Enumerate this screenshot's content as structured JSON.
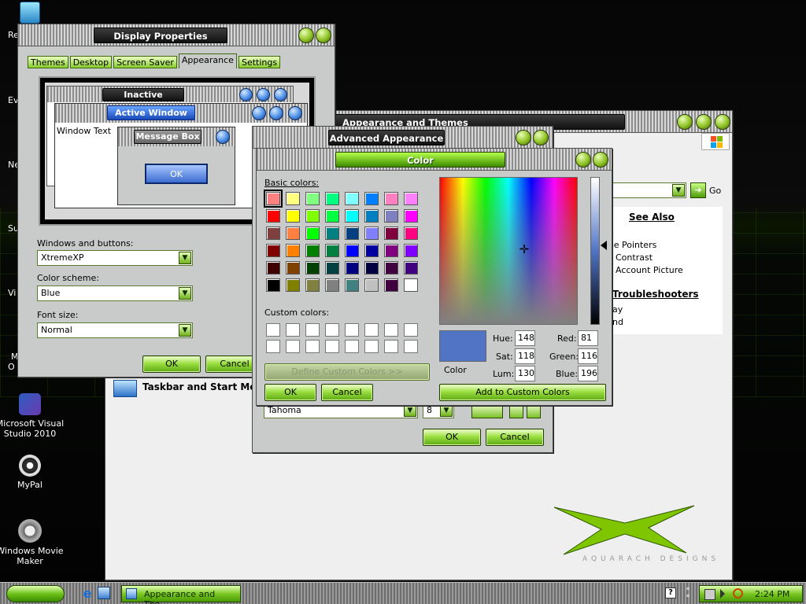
{
  "desktop": {
    "stubs": [
      "Re",
      "Ev",
      "Ne",
      "Su",
      "Vi",
      "M",
      "O"
    ],
    "icons": [
      {
        "label": "Microsoft Visual Studio 2010"
      },
      {
        "label": "MyPal"
      },
      {
        "label": "Windows Movie Maker"
      }
    ]
  },
  "display_properties": {
    "title": "Display Properties",
    "tabs": [
      "Themes",
      "Desktop",
      "Screen Saver",
      "Appearance",
      "Settings"
    ],
    "selected_tab": "Appearance",
    "preview": {
      "inactive": "Inactive Window",
      "active": "Active Window",
      "window_text": "Window Text",
      "message_box": "Message Box",
      "ok": "OK"
    },
    "windows_buttons_label": "Windows and buttons:",
    "windows_buttons_value": "XtremeXP",
    "color_scheme_label": "Color scheme:",
    "color_scheme_value": "Blue",
    "font_size_label": "Font size:",
    "font_size_value": "Normal",
    "ok": "OK",
    "cancel": "Cancel"
  },
  "appearance_themes": {
    "title": "Appearance and Themes",
    "go": "Go",
    "see_also": "See Also",
    "see_also_items": [
      "s",
      "se Pointers",
      "Contrast",
      "Account Picture"
    ],
    "troubleshooters": "Troubleshooters",
    "troubleshooter_items": [
      "ay",
      "nd"
    ],
    "taskbar_link": "Taskbar and Start Menu",
    "brand": "AQUARACH DESIGNS"
  },
  "advanced_appearance": {
    "title": "Advanced Appearance",
    "font_value": "Tahoma",
    "size_value": "8",
    "ok": "OK",
    "cancel": "Cancel"
  },
  "color_dialog": {
    "title": "Color",
    "basic_label": "Basic colors:",
    "custom_label": "Custom colors:",
    "define_custom": "Define Custom Colors >>",
    "ok": "OK",
    "cancel": "Cancel",
    "add_custom": "Add to Custom Colors",
    "color_label": "Color",
    "hue_label": "Hue:",
    "hue": "148",
    "sat_label": "Sat:",
    "sat": "118",
    "lum_label": "Lum:",
    "lum": "130",
    "red_label": "Red:",
    "red": "81",
    "green_label": "Green:",
    "green": "116",
    "blue_label": "Blue:",
    "blue": "196",
    "current_color": "#5174c4",
    "basic_colors": [
      "#ff8080",
      "#ffff80",
      "#80ff80",
      "#00ff80",
      "#80ffff",
      "#0080ff",
      "#ff80c0",
      "#ff80ff",
      "#ff0000",
      "#ffff00",
      "#80ff00",
      "#00ff40",
      "#00ffff",
      "#0080c0",
      "#8080c0",
      "#ff00ff",
      "#804040",
      "#ff8040",
      "#00ff00",
      "#008080",
      "#004080",
      "#8080ff",
      "#800040",
      "#ff0080",
      "#800000",
      "#ff8000",
      "#008000",
      "#008040",
      "#0000ff",
      "#0000a0",
      "#800080",
      "#8000ff",
      "#400000",
      "#804000",
      "#004000",
      "#004040",
      "#000080",
      "#000040",
      "#400040",
      "#400080",
      "#000000",
      "#808000",
      "#808040",
      "#808080",
      "#408080",
      "#c0c0c0",
      "#400040",
      "#ffffff"
    ],
    "selected_basic_index": 0
  },
  "taskbar": {
    "task_label": "Appearance and The...",
    "time": "2:24 PM",
    "help_glyph": "?"
  }
}
